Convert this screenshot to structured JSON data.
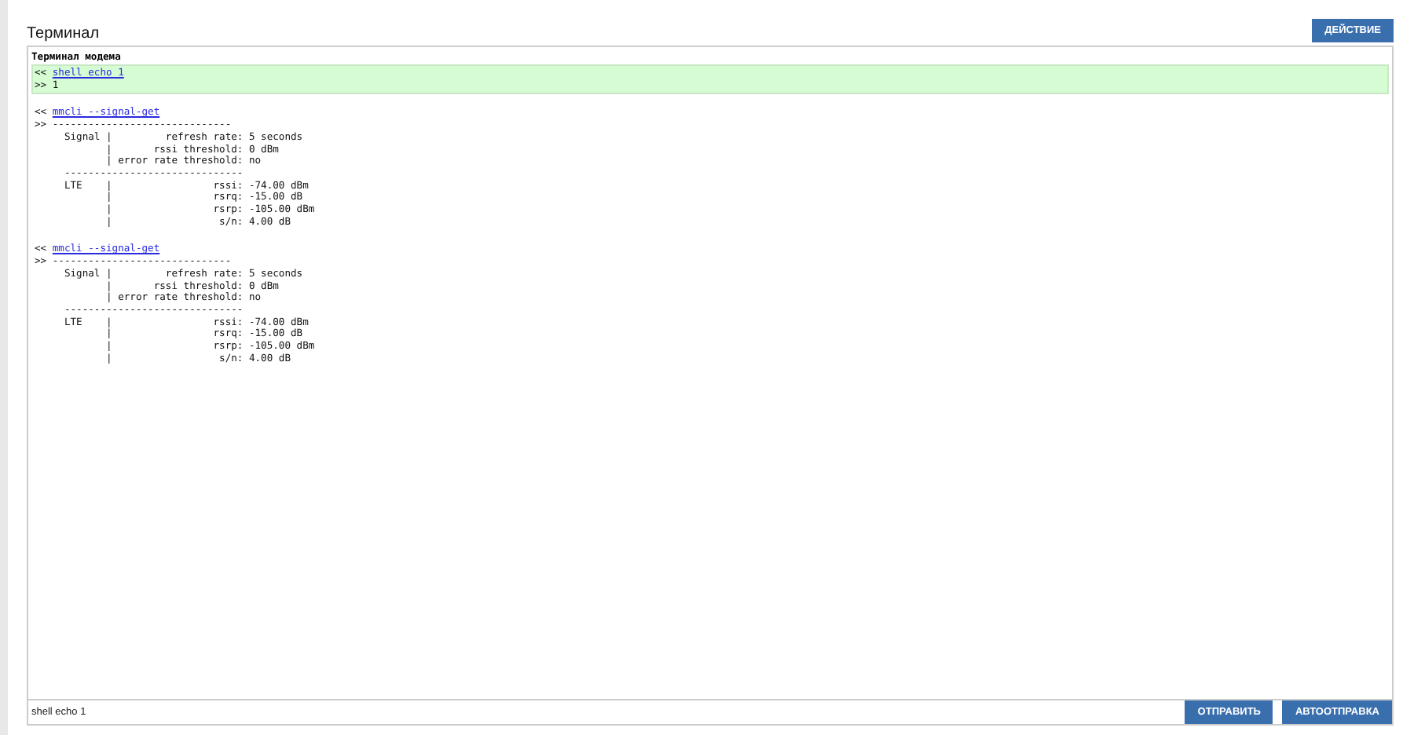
{
  "page_title": "Терминал",
  "action_button": "ДЕЙСТВИЕ",
  "terminal": {
    "title": "Терминал модема",
    "entries": [
      {
        "highlighted": true,
        "prompt": "<<",
        "command": "shell echo 1",
        "output": [
          ">> 1"
        ]
      },
      {
        "highlighted": false,
        "prompt": "<<",
        "command": "mmcli --signal-get",
        "output": [
          ">> ------------------------------",
          "     Signal |         refresh rate: 5 seconds",
          "            |       rssi threshold: 0 dBm",
          "            | error rate threshold: no",
          "     ------------------------------",
          "     LTE    |                 rssi: -74.00 dBm",
          "            |                 rsrq: -15.00 dB",
          "            |                 rsrp: -105.00 dBm",
          "            |                  s/n: 4.00 dB"
        ]
      },
      {
        "highlighted": false,
        "prompt": "<<",
        "command": "mmcli --signal-get",
        "output": [
          ">> ------------------------------",
          "     Signal |         refresh rate: 5 seconds",
          "            |       rssi threshold: 0 dBm",
          "            | error rate threshold: no",
          "     ------------------------------",
          "     LTE    |                 rssi: -74.00 dBm",
          "            |                 rsrq: -15.00 dB",
          "            |                 rsrp: -105.00 dBm",
          "            |                  s/n: 4.00 dB"
        ]
      }
    ]
  },
  "command_input": {
    "value": "shell echo 1"
  },
  "buttons": [
    "ОТПРАВИТЬ",
    "АВТООТПРАВКА"
  ]
}
